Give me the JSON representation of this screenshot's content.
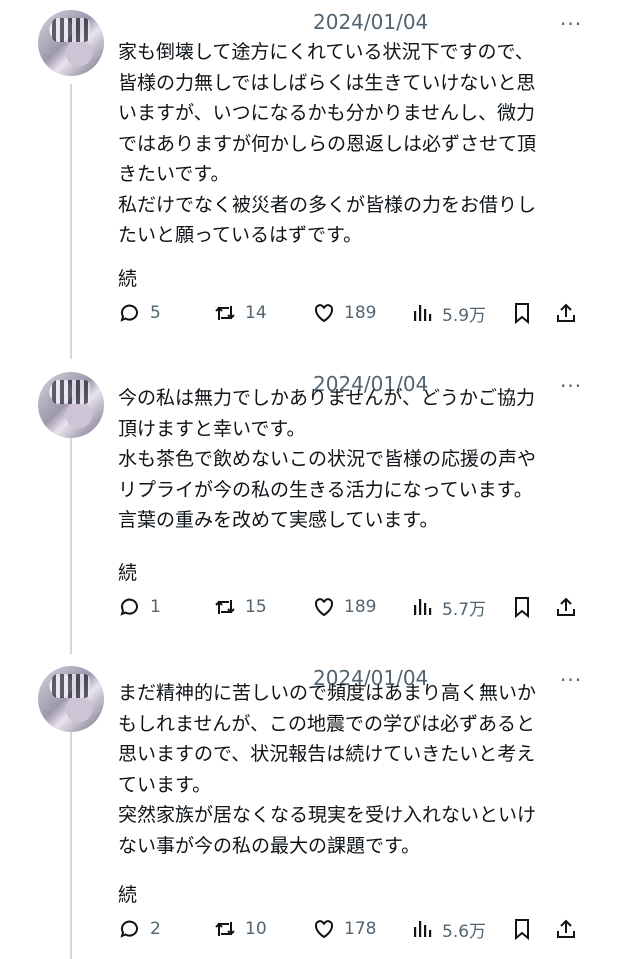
{
  "tweets": [
    {
      "date": "2024/01/04",
      "more": "···",
      "lines": [
        "家も倒壊して途方にくれている状況下ですので、",
        "皆様の力無しではしばらくは生きていけないと思",
        "いますが、いつになるかも分かりませんし、微力",
        "ではありますが何かしらの恩返しは必ずさせて頂",
        "きたいです。",
        "私だけでなく被災者の多くが皆様の力をお借りし",
        "たいと願っているはずです。"
      ],
      "continued": "続",
      "replies": "5",
      "retweets": "14",
      "likes": "189",
      "views": "5.9万"
    },
    {
      "date": "2024/01/04",
      "more": "···",
      "lines": [
        "今の私は無力でしかありませんが、どうかご協力",
        "頂けますと幸いです。",
        "水も茶色で飲めないこの状況で皆様の応援の声や",
        "リプライが今の私の生きる活力になっています。",
        "言葉の重みを改めて実感しています。"
      ],
      "continued": "続",
      "replies": "1",
      "retweets": "15",
      "likes": "189",
      "views": "5.7万"
    },
    {
      "date": "2024/01/04",
      "more": "···",
      "lines": [
        "まだ精神的に苦しいので頻度はあまり高く無いか",
        "もしれませんが、この地震での学びは必ずあると",
        "思いますので、状況報告は続けていきたいと考え",
        "ています。",
        "突然家族が居なくなる現実を受け入れないといけ",
        "ない事が今の私の最大の課題です。"
      ],
      "continued": "続",
      "replies": "2",
      "retweets": "10",
      "likes": "178",
      "views": "5.6万"
    }
  ]
}
